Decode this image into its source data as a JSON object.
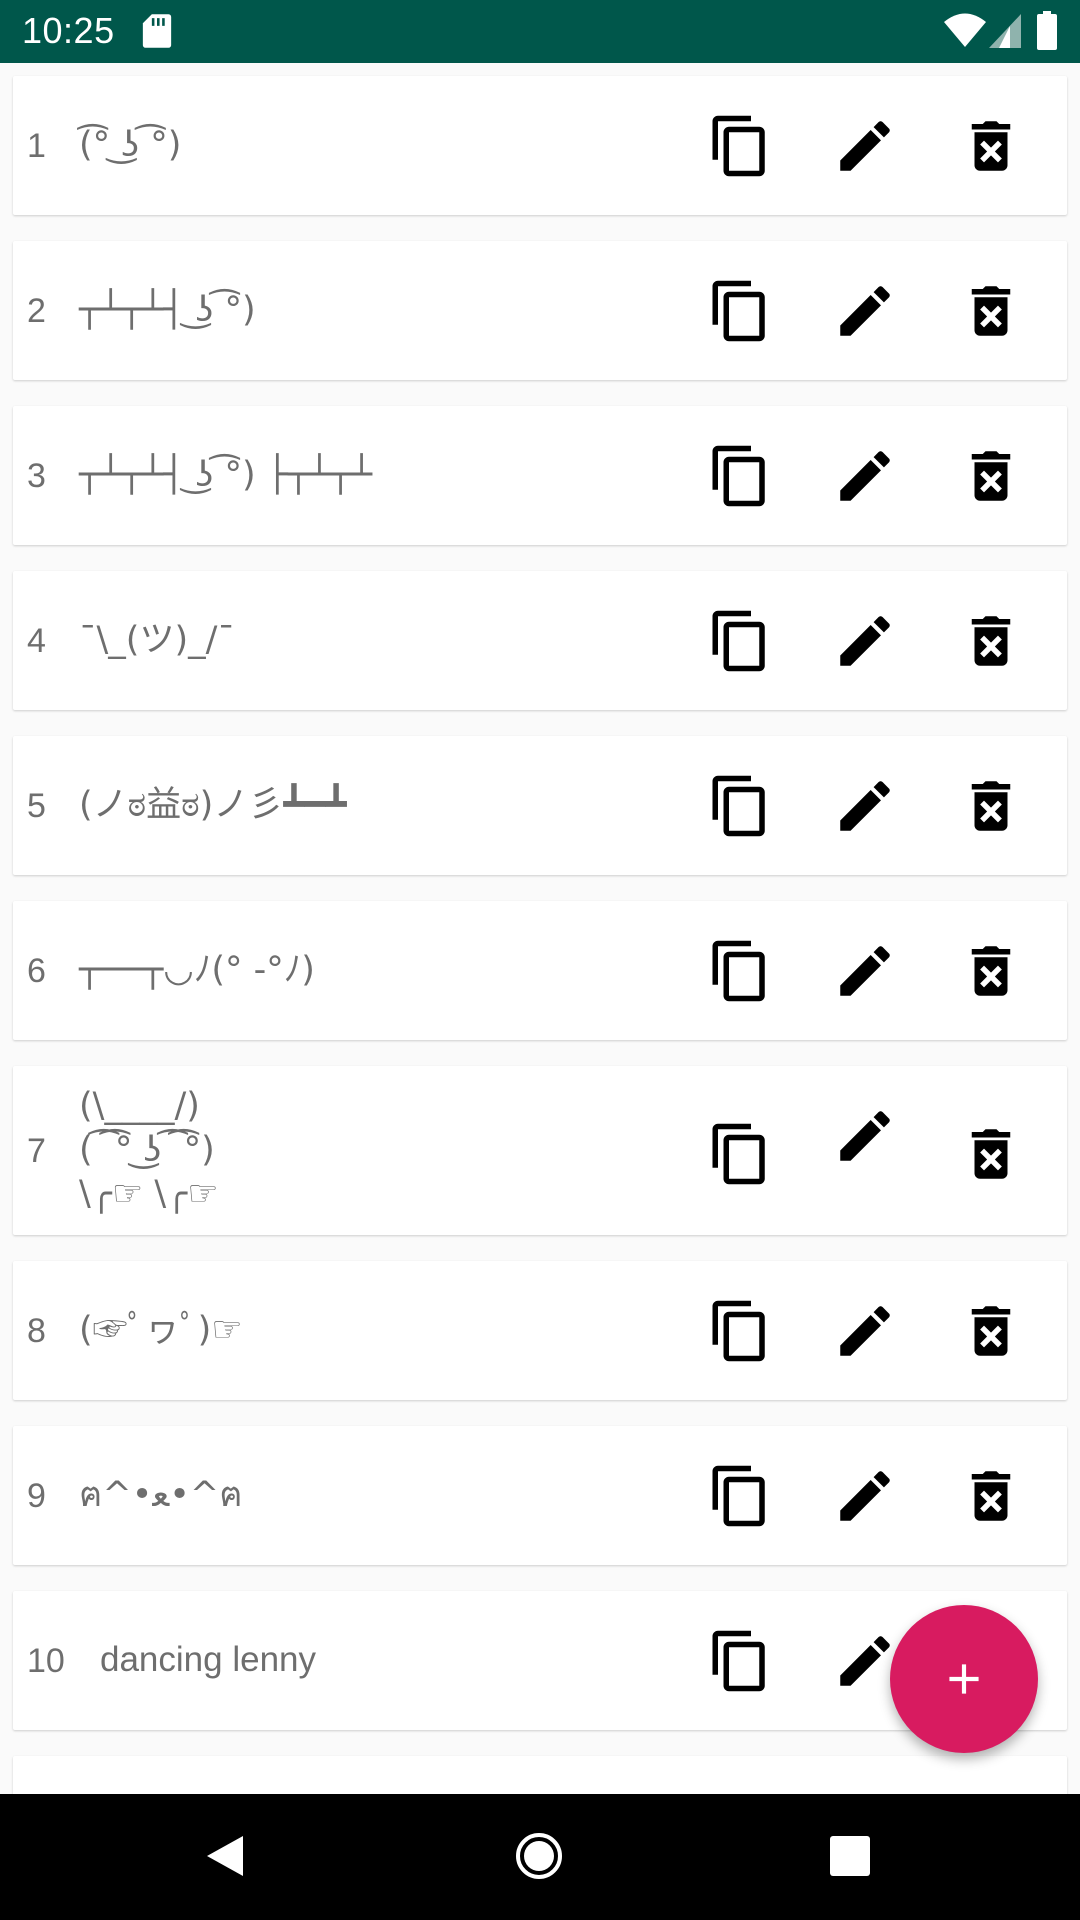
{
  "status_bar": {
    "time": "10:25",
    "icons": [
      "sd-card-icon",
      "wifi-icon",
      "signal-icon",
      "battery-icon"
    ],
    "background": "#00574b"
  },
  "list": {
    "items": [
      {
        "number": "1",
        "text": "(͡° ͜ʖ ͡°)"
      },
      {
        "number": "2",
        "text": "┬┴┬┴┤ ͜ʖ ͡°)"
      },
      {
        "number": "3",
        "text": "┬┴┬┴┤ ͜ʖ ͡°) ├┬┴┬┴"
      },
      {
        "number": "4",
        "text": "¯\\_(ツ)_/¯"
      },
      {
        "number": "5",
        "text": "(ノಠ益ಠ)ノ彡┻━┻"
      },
      {
        "number": "6",
        "text": "┬──┬◡ﾉ(° -°ﾉ)"
      },
      {
        "number": "7",
        "text": "(\\____/)\n( ͡ ͡° ͜ʖ ͡ ͡°)\n\\╭☞ \\╭☞"
      },
      {
        "number": "8",
        "text": "(☞ﾟヮﾟ)☞"
      },
      {
        "number": "9",
        "text": "ฅ^•ﻌ•^ฅ"
      },
      {
        "number": "10",
        "text": "dancing lenny"
      }
    ],
    "actions": [
      "copy-icon",
      "edit-icon",
      "delete-icon"
    ]
  },
  "fab": {
    "icon": "plus-icon",
    "color": "#d81b60"
  },
  "nav_bar": {
    "icons": [
      "back-icon",
      "home-icon",
      "recents-icon"
    ]
  }
}
